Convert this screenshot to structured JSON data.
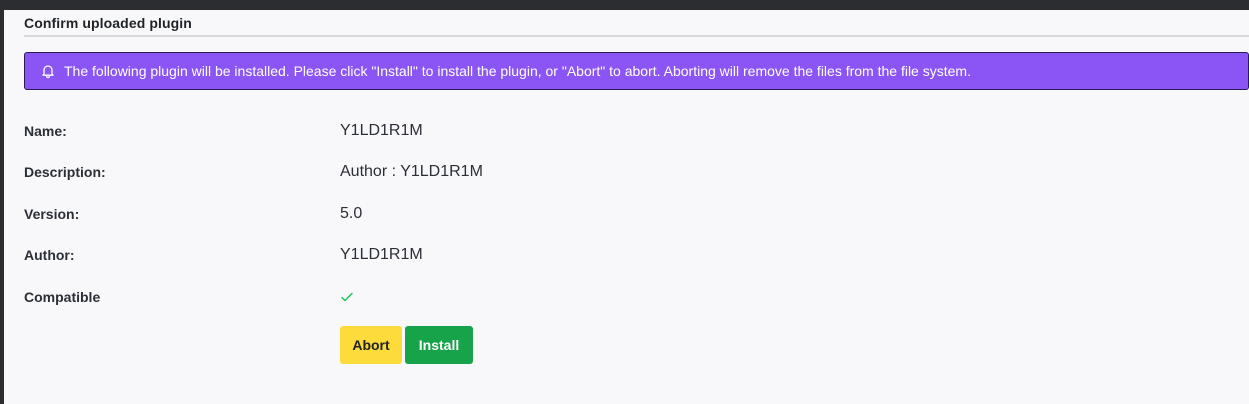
{
  "panel": {
    "title": "Confirm uploaded plugin"
  },
  "alert": {
    "icon": "bell-icon",
    "message": "The following plugin will be installed. Please click \"Install\" to install the plugin, or \"Abort\" to abort. Aborting will remove the files from the file system.",
    "background": "#8b55f5"
  },
  "details": {
    "name_label": "Name:",
    "name_value": "Y1LD1R1M",
    "description_label": "Description:",
    "description_value": "Author : Y1LD1R1M",
    "version_label": "Version:",
    "version_value": "5.0",
    "author_label": "Author:",
    "author_value": "Y1LD1R1M",
    "compatible_label": "Compatible",
    "compatible_icon": "checkmark-icon",
    "compatible_color": "#22c55e"
  },
  "actions": {
    "abort_label": "Abort",
    "install_label": "Install",
    "abort_color": "#fcdb3a",
    "install_color": "#16a34a"
  }
}
